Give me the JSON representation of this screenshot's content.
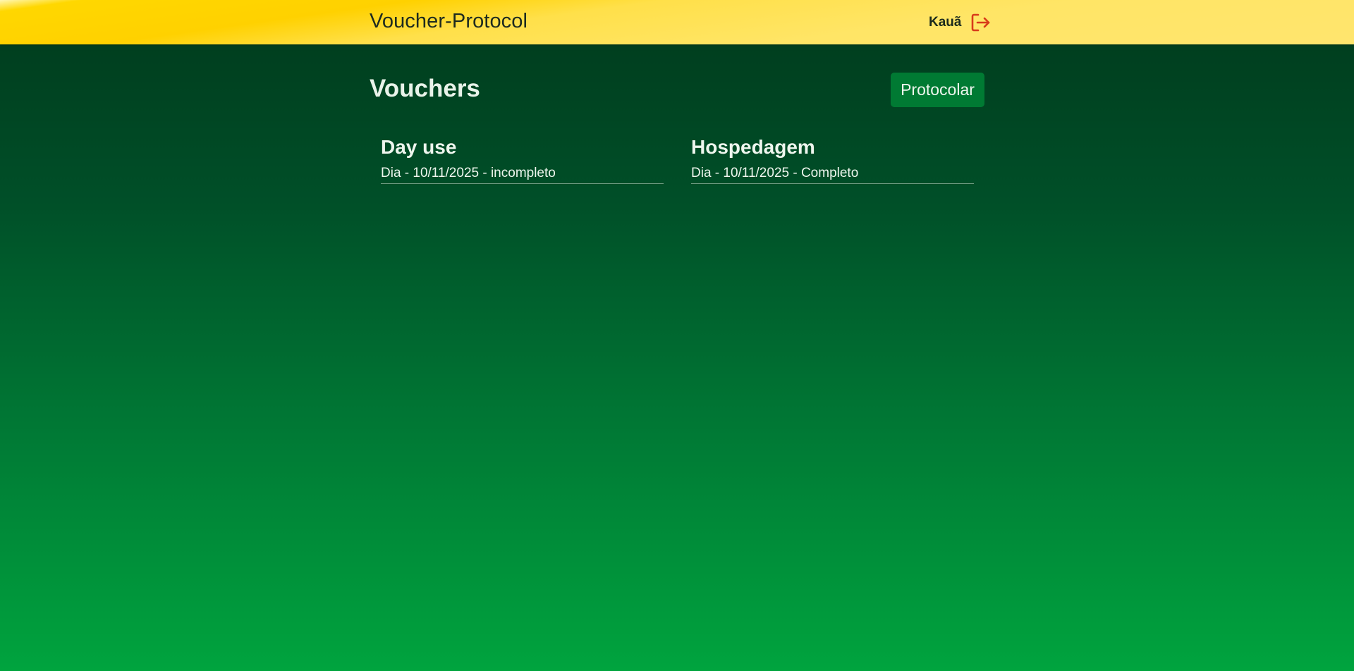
{
  "header": {
    "brand": "Voucher-Protocol",
    "user_name": "Kauã",
    "logout_icon": "logout-icon",
    "logout_icon_color": "#d83b1a"
  },
  "main": {
    "title": "Vouchers",
    "protocolar_label": "Protocolar",
    "cards": [
      {
        "title": "Day use",
        "entry": "Dia - 10/11/2025 - incompleto"
      },
      {
        "title": "Hospedagem",
        "entry": "Dia - 10/11/2025 - Completo"
      }
    ]
  },
  "colors": {
    "topbar": "#ffd700",
    "button": "#007a33",
    "background_top": "#003a1c",
    "background_bottom": "#00a43e"
  }
}
